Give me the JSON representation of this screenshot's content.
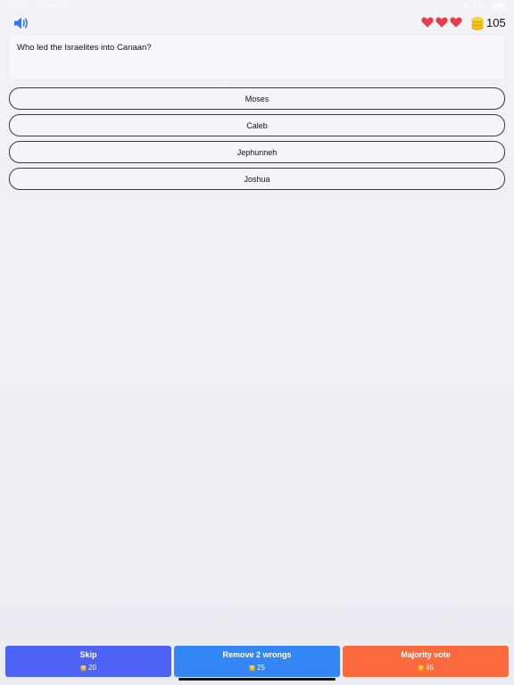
{
  "status_bar": {
    "time": "9:41 PM",
    "date": "Thu Jun 24",
    "battery": "100%"
  },
  "stats": {
    "lives": 3,
    "coins": "105"
  },
  "question": {
    "text": "Who led the Israelites into Canaan?"
  },
  "answers": [
    {
      "label": "Moses"
    },
    {
      "label": "Caleb"
    },
    {
      "label": "Jephunneh"
    },
    {
      "label": "Joshua"
    }
  ],
  "lifelines": [
    {
      "label": "Skip",
      "cost": "20",
      "color": "#4d63f6"
    },
    {
      "label": "Remove 2 wrongs",
      "cost": "25",
      "color": "#3586f5"
    },
    {
      "label": "Majority vote",
      "cost": "45",
      "color": "#fb6a3c"
    }
  ],
  "icons": {
    "sound": "speaker-icon",
    "life": "heart-icon",
    "currency": "coin-stack-icon"
  },
  "colors": {
    "accent": "#2f7cf6",
    "heart": "#ea3b4a",
    "coin": "#f5c518"
  }
}
